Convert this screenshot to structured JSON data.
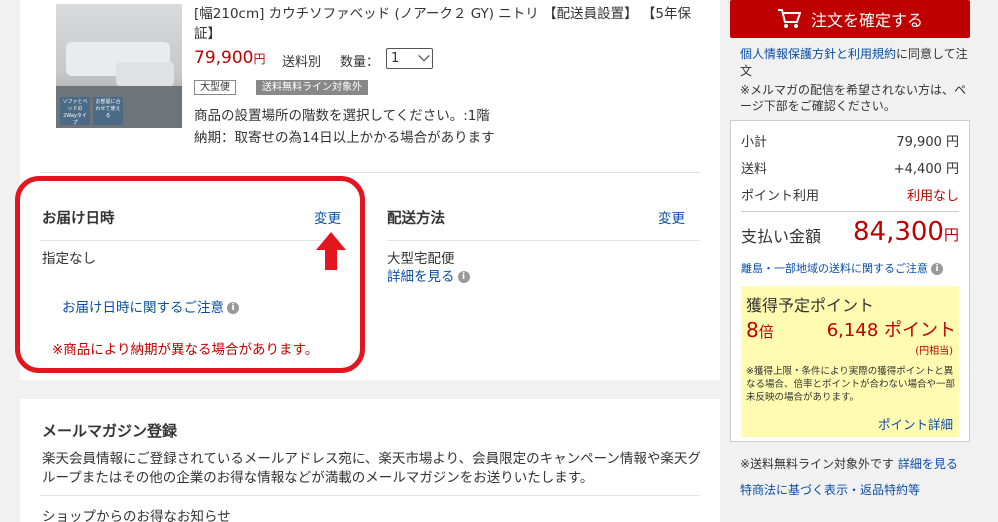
{
  "product": {
    "title": "[幅210cm] カウチソファベッド (ノアーク２ GY) ニトリ 【配送員設置】 【5年保証】",
    "price": "79,900",
    "price_unit": "円",
    "shipping": "送料別",
    "quantity_label": "数量：",
    "quantity_value": "1",
    "badge_large": "大型便",
    "badge_free": "送料無料ライン対象外",
    "floor_note": "商品の設置場所の階数を選択してください。:1階",
    "delivery_note": "納期：取寄せの為14日以上かかる場合があります",
    "thumb_tag1": "ソファとベッドの2Wayタイプ",
    "thumb_tag2": "お部屋に合わせて使える"
  },
  "delivery_time": {
    "title": "お届け日時",
    "change": "変更",
    "value": "指定なし",
    "note": "お届け日時に関するご注意",
    "warning": "※商品により納期が異なる場合があります。"
  },
  "shipping_method": {
    "title": "配送方法",
    "change": "変更",
    "value": "大型宅配便",
    "detail": "詳細を見る"
  },
  "mail": {
    "title": "メールマガジン登録",
    "text": "楽天会員情報にご登録されているメールアドレス宛に、楽天市場より、会員限定のキャンペーン情報や楽天グループまたはその他の企業のお得な情報などが満載のメールマガジンをお送りいたします。",
    "sub": "ショップからのお得なお知らせ"
  },
  "sidebar": {
    "confirm": "注文を確定する",
    "agree_link": "個人情報保護方針と利用規約",
    "agree_text": "に同意して注文",
    "mail_note": "※メルマガの配信を希望されない方は、ページ下部をご確認ください。",
    "subtotal_label": "小計",
    "subtotal": "79,900 円",
    "shipping_label": "送料",
    "shipping": "+4,400 円",
    "points_use_label": "ポイント利用",
    "points_use": "利用なし",
    "total_label": "支払い金額",
    "total": "84,300",
    "total_unit": "円",
    "island_note": "離島・一部地域の送料に関するご注意",
    "points_title": "獲得予定ポイント",
    "points_mult": "8",
    "points_mult_unit": "倍",
    "points_value": "6,148 ポイント",
    "points_sub": "(円相当)",
    "points_note": "※獲得上限・条件により実際の獲得ポイントと異なる場合、倍率とポイントが合わない場合や一部未反映の場合があります。",
    "points_link": "ポイント詳細",
    "free_line": "※送料無料ライン対象外です",
    "free_line_link": "詳細を見る",
    "legal": "特商法に基づく表示・返品特約等"
  },
  "colors": {
    "accent": "#bf0000",
    "link": "#0a4eaa",
    "highlight": "#e3161f",
    "points_bg": "#fffbb0"
  }
}
